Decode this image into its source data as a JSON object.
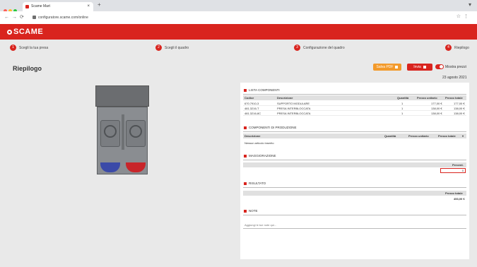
{
  "browser": {
    "tab_title": "Scame Mart",
    "url": "configuratore.scame.com/online",
    "new_tab": "+",
    "tab_close": "×"
  },
  "brand": {
    "logo_text": "SCAME",
    "color": "#d9241e"
  },
  "steps": [
    {
      "number": "1",
      "label": "Scegli la tua presa"
    },
    {
      "number": "2",
      "label": "Scegli il quadro"
    },
    {
      "number": "3",
      "label": "Configurazione del quadro"
    },
    {
      "number": "4",
      "label": "Riepilogo"
    }
  ],
  "page": {
    "title": "Riepilogo"
  },
  "actions": {
    "save_label": "Salva PDF",
    "save_color": "#f39a2b",
    "send_label": "Invia",
    "send_color": "#d9241e",
    "toggle_label": "Mostra prezzi",
    "date": "23 agosto 2021"
  },
  "components": {
    "section_title": "LISTA COMPONENTI",
    "headers": [
      "Codice",
      "Descrizione",
      "Quantità",
      "Prezzo unitario",
      "Prezzo totale"
    ],
    "rows": [
      [
        "670.7910-3",
        "SUPPORTO MODULARE",
        "1",
        "177,00 €",
        "177,00 €"
      ],
      [
        "481.3216-T",
        "PRESA INTERBLOCCATA",
        "1",
        "138,00 €",
        "138,00 €"
      ],
      [
        "481.3216-8C",
        "PRESA INTERBLOCCATA",
        "1",
        "138,00 €",
        "138,00 €"
      ]
    ]
  },
  "production": {
    "section_title": "COMPONENTI DI PRODUZIONE",
    "headers": [
      "Descrizione",
      "Quantità",
      "Prezzo unitario",
      "Prezzo totale"
    ],
    "empty_text": "Nessun articolo inserito"
  },
  "discount": {
    "section_title": "MAGGIORAZIONE",
    "header": "Percent.",
    "value": "0"
  },
  "result": {
    "section_title": "RISULTATO",
    "header": "Prezzo totale",
    "value": "453,00 €"
  },
  "notes": {
    "section_title": "NOTE",
    "placeholder": "Aggiungi le tue note qui..."
  }
}
